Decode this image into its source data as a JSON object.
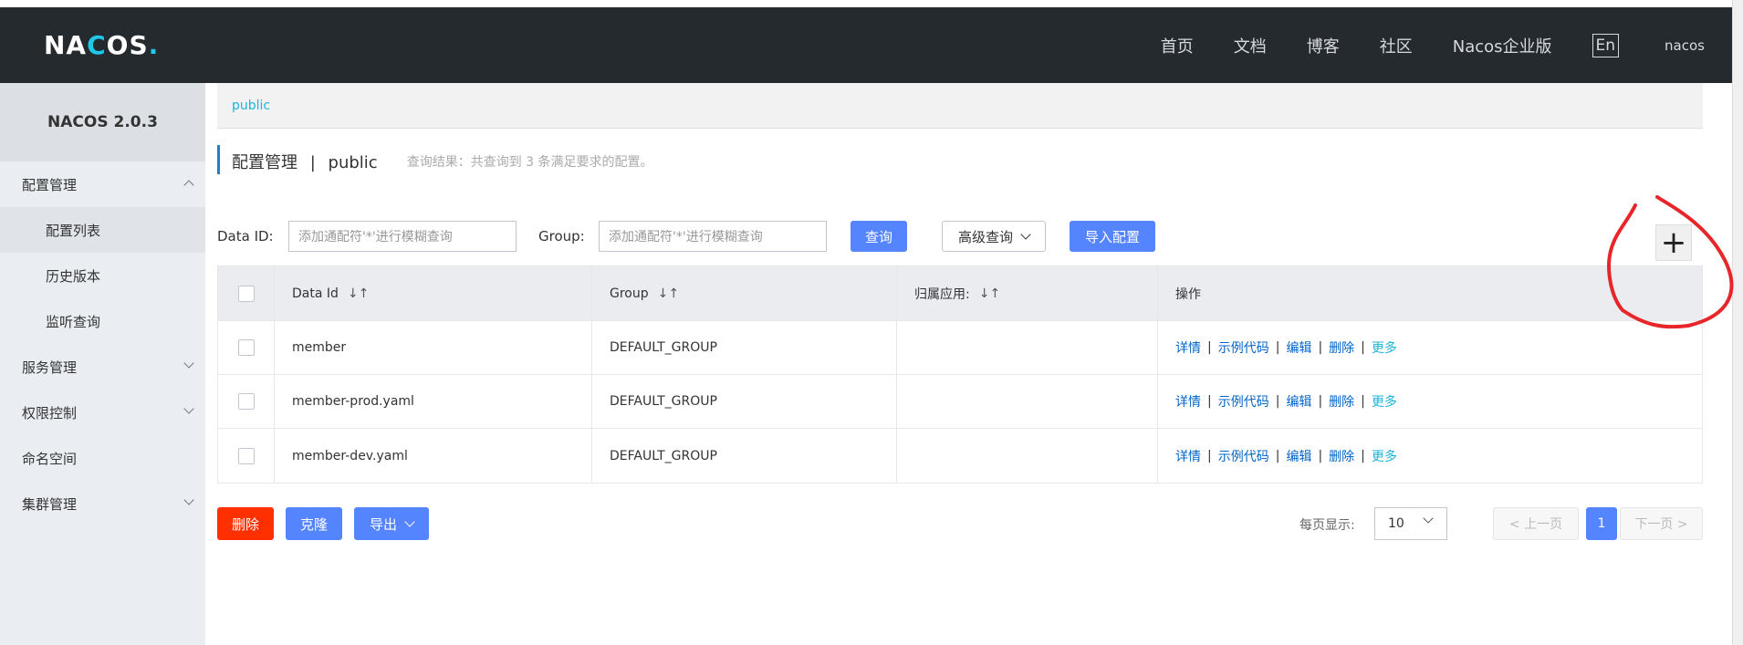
{
  "header": {
    "logo": "NACOS.",
    "nav": [
      "首页",
      "文档",
      "博客",
      "社区",
      "Nacos企业版"
    ],
    "lang": "En",
    "user": "nacos"
  },
  "sidebar": {
    "title": "NACOS 2.0.3",
    "items": [
      {
        "label": "配置管理"
      },
      {
        "label": "配置列表"
      },
      {
        "label": "历史版本"
      },
      {
        "label": "监听查询"
      },
      {
        "label": "服务管理"
      },
      {
        "label": "权限控制"
      },
      {
        "label": "命名空间"
      },
      {
        "label": "集群管理"
      }
    ]
  },
  "breadcrumb": "public",
  "page": {
    "title": "配置管理",
    "separator": "|",
    "namespace": "public",
    "query_result": "查询结果：共查询到 3 条满足要求的配置。"
  },
  "search": {
    "dataid_label": "Data ID:",
    "dataid_placeholder": "添加通配符'*'进行模糊查询",
    "group_label": "Group:",
    "group_placeholder": "添加通配符'*'进行模糊查询",
    "query_btn": "查询",
    "advanced_btn": "高级查询",
    "import_btn": "导入配置"
  },
  "table": {
    "headers": [
      "Data Id",
      "Group",
      "归属应用:",
      "操作"
    ],
    "sort_glyph": "↓↑",
    "rows": [
      {
        "dataid": "member",
        "group": "DEFAULT_GROUP",
        "app": ""
      },
      {
        "dataid": "member-prod.yaml",
        "group": "DEFAULT_GROUP",
        "app": ""
      },
      {
        "dataid": "member-dev.yaml",
        "group": "DEFAULT_GROUP",
        "app": ""
      }
    ],
    "ops": {
      "detail": "详情",
      "sample": "示例代码",
      "edit": "编辑",
      "delete": "删除",
      "more": "更多",
      "sep": "|"
    }
  },
  "footer": {
    "delete_btn": "删除",
    "clone_btn": "克隆",
    "export_btn": "导出",
    "page_size_label": "每页显示:",
    "page_size": "10",
    "prev": "< 上一页",
    "current_page": "1",
    "next": "下一页 >"
  },
  "plus_symbol": "+",
  "colors": {
    "topbar": "#252a2f",
    "primary": "#5584ff",
    "danger": "#ff3000",
    "link": "#0064c8",
    "annotation": "#e8262a"
  }
}
